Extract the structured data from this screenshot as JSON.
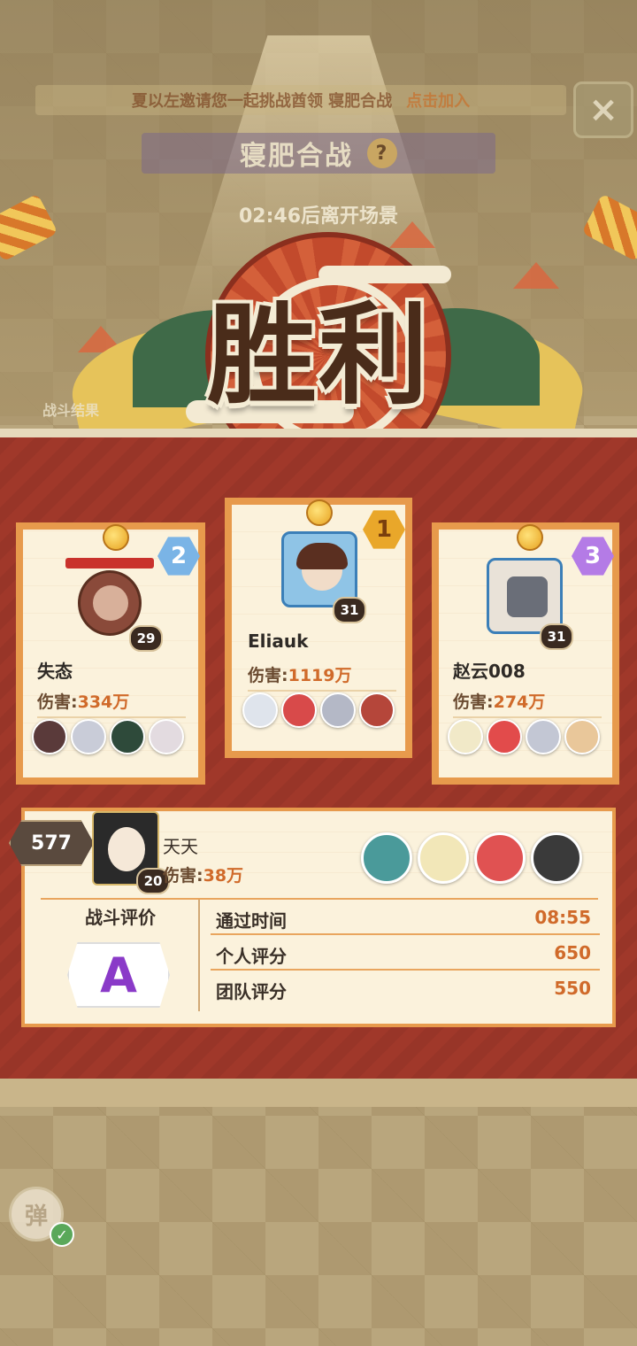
{
  "scene": {
    "invite_text": "夏以左邀请您一起挑战酋领 寝肥合战",
    "invite_link": "点击加入",
    "mode_title": "寝肥合战",
    "timer_text": "02:46后离开场景",
    "battle_result_label": "战斗结果"
  },
  "result": {
    "title": "胜利"
  },
  "players": [
    {
      "rank": "2",
      "name": "失态",
      "level": "29",
      "damage_label": "伤害:",
      "damage_value": "334万"
    },
    {
      "rank": "1",
      "name": "Eliauk",
      "level": "31",
      "damage_label": "伤害:",
      "damage_value": "1119万"
    },
    {
      "rank": "3",
      "name": "赵云008",
      "level": "31",
      "damage_label": "伤害:",
      "damage_value": "274万"
    }
  ],
  "self": {
    "rank": "577",
    "name": "天天",
    "level": "20",
    "damage_label": "伤害:",
    "damage_value": "38万",
    "grade_label": "战斗评价",
    "grade": "A",
    "stats": [
      {
        "label": "通过时间",
        "value": "08:55"
      },
      {
        "label": "个人评分",
        "value": "650"
      },
      {
        "label": "团队评分",
        "value": "550"
      }
    ]
  },
  "controls": {
    "close_icon": "×",
    "danmaku_label": "弹"
  },
  "colors": {
    "panel_red": "#a0382a",
    "card_border": "#e79a4c",
    "damage_orange": "#d06a2a",
    "grade_purple": "#8a3ac8"
  }
}
